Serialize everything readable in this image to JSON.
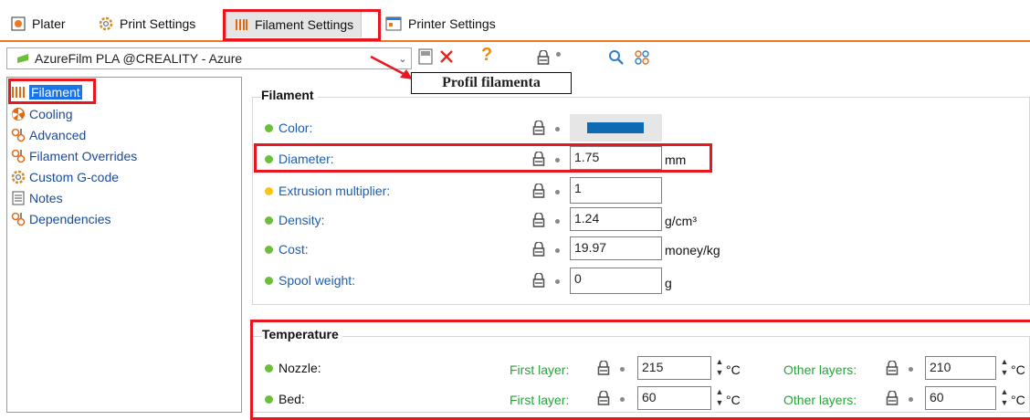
{
  "tabs": [
    {
      "label": "Plater",
      "icon": "plater-icon"
    },
    {
      "label": "Print Settings",
      "icon": "gear-icon"
    },
    {
      "label": "Filament Settings",
      "icon": "filament-icon"
    },
    {
      "label": "Printer Settings",
      "icon": "printer-icon"
    }
  ],
  "preset": {
    "name": "AzureFilm PLA @CREALITY - Azure"
  },
  "annotation": "Profil filamenta",
  "tree": [
    {
      "label": "Filament"
    },
    {
      "label": "Cooling"
    },
    {
      "label": "Advanced"
    },
    {
      "label": "Filament Overrides"
    },
    {
      "label": "Custom G-code"
    },
    {
      "label": "Notes"
    },
    {
      "label": "Dependencies"
    }
  ],
  "filament_group": {
    "title": "Filament",
    "color": {
      "label": "Color:",
      "value": "#0e6ab3"
    },
    "diameter": {
      "label": "Diameter:",
      "value": "1.75",
      "unit": "mm"
    },
    "extrusion": {
      "label": "Extrusion multiplier:",
      "value": "1"
    },
    "density": {
      "label": "Density:",
      "value": "1.24",
      "unit": "g/cm³"
    },
    "cost": {
      "label": "Cost:",
      "value": "19.97",
      "unit": "money/kg"
    },
    "spool": {
      "label": "Spool weight:",
      "value": "0",
      "unit": "g"
    }
  },
  "temperature_group": {
    "title": "Temperature",
    "first_layer_label": "First layer:",
    "other_layers_label": "Other layers:",
    "unit": "°C",
    "nozzle": {
      "label": "Nozzle:",
      "first": "215",
      "other": "210"
    },
    "bed": {
      "label": "Bed:",
      "first": "60",
      "other": "60"
    }
  },
  "colors": {
    "accent": "#ee7722",
    "highlight": "#e8161f",
    "simple_dot": "#6cbf3a",
    "advanced_dot": "#f5c518",
    "link": "#1a5fae",
    "selected": "#1a73e8"
  }
}
